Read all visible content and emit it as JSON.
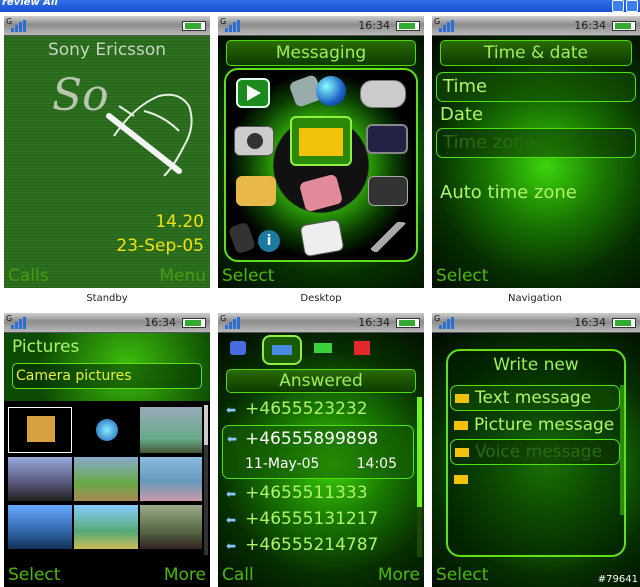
{
  "window": {
    "title": "review All"
  },
  "standby": {
    "caption": "Standby",
    "brand": "Sony Ericsson",
    "logo_text": "So",
    "time": "14.20",
    "date": "23-Sep-05",
    "soft_left": "Calls",
    "soft_right": "Menu"
  },
  "desktop": {
    "caption": "Desktop",
    "time": "16:34",
    "header": "Messaging",
    "soft_left": "Select",
    "icons": [
      "play-icon",
      "phone-icon",
      "globe-icon",
      "gamepad-icon",
      "camera-icon",
      "envelope-icon",
      "film-icon",
      "folder-icon",
      "notebook-icon",
      "radio-icon",
      "mobile-icon",
      "info-icon",
      "calendar-icon",
      "tools-icon"
    ]
  },
  "navigation": {
    "caption": "Navigation",
    "time": "16:34",
    "header": "Time & date",
    "items": [
      "Time",
      "Date",
      "Time zone",
      "Auto time zone"
    ],
    "soft_left": "Select"
  },
  "pictures": {
    "time": "16:34",
    "title": "Pictures",
    "subtitle": "Camera pictures",
    "soft_left": "Select",
    "soft_right": "More"
  },
  "calls": {
    "time": "16:34",
    "header": "Answered",
    "numbers": [
      "+4655523232",
      "+46555899898",
      "+4655511333",
      "+46555131217",
      "+46555214787"
    ],
    "selected_date": "11-May-05",
    "selected_time": "14:05",
    "soft_left": "Call",
    "soft_right": "More"
  },
  "write": {
    "time": "16:34",
    "header": "Write new",
    "items": [
      "Text message",
      "Picture message",
      "Voice message"
    ],
    "soft_left": "Select"
  },
  "watermark": "#79641",
  "colors": {
    "accent": "#4cb80a",
    "text_green": "#9df05a",
    "standby_bg": "#2a6a1a"
  }
}
